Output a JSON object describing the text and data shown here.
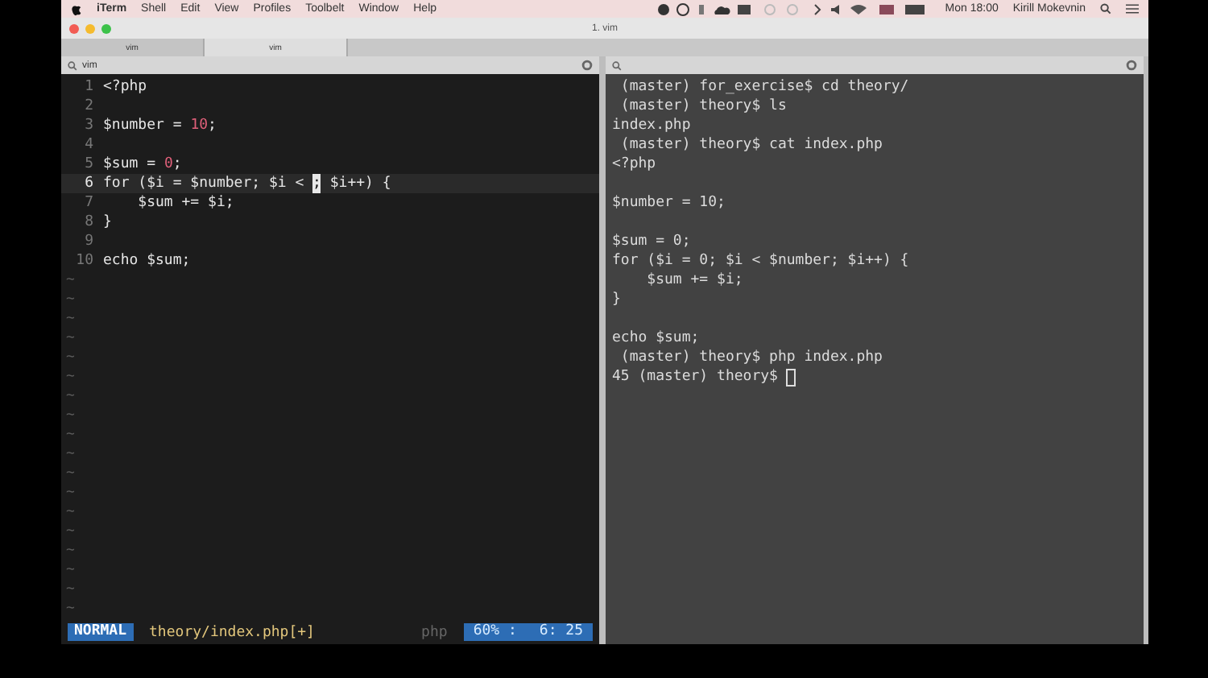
{
  "menu_bar": {
    "items": [
      "iTerm",
      "Shell",
      "Edit",
      "View",
      "Profiles",
      "Toolbelt",
      "Window",
      "Help"
    ],
    "clock": "Mon 18:00",
    "user": "Kirill Mokevnin"
  },
  "window": {
    "title": "1. vim"
  },
  "tabs": [
    {
      "label": "vim",
      "selected": false
    },
    {
      "label": "vim",
      "selected": true
    }
  ],
  "left_pane": {
    "title": "vim",
    "lines": [
      {
        "number": "1",
        "current": false,
        "tokens": [
          {
            "text": "<?php",
            "kind": "plain"
          }
        ]
      },
      {
        "number": "2",
        "current": false
      },
      {
        "number": "3",
        "current": false,
        "tokens": [
          {
            "text": "$number = ",
            "kind": "plain"
          },
          {
            "text": "10",
            "kind": "number"
          },
          {
            "text": ";",
            "kind": "plain"
          }
        ]
      },
      {
        "number": "4",
        "current": false
      },
      {
        "number": "5",
        "current": false,
        "tokens": [
          {
            "text": "$sum = ",
            "kind": "plain"
          },
          {
            "text": "0",
            "kind": "number"
          },
          {
            "text": ";",
            "kind": "plain"
          }
        ]
      },
      {
        "number": "6",
        "current": true,
        "tokens": [
          {
            "text": "for ($i = $number; $i < ",
            "kind": "plain"
          },
          {
            "text": ";",
            "kind": "cursor"
          },
          {
            "text": " $i++) {",
            "kind": "plain"
          }
        ]
      },
      {
        "number": "7",
        "current": false,
        "tokens": [
          {
            "text": "    $sum += $i;",
            "kind": "plain"
          }
        ]
      },
      {
        "number": "8",
        "current": false,
        "tokens": [
          {
            "text": "}",
            "kind": "plain"
          }
        ]
      },
      {
        "number": "9",
        "current": false
      },
      {
        "number": "10",
        "current": false,
        "tokens": [
          {
            "text": "echo $sum;",
            "kind": "plain"
          }
        ]
      }
    ],
    "filler_lines": [
      "~",
      "~",
      "~",
      "~",
      "~",
      "~",
      "~",
      "~",
      "~",
      "~",
      "~",
      "~",
      "~",
      "~",
      "~",
      "~",
      "~",
      "~"
    ],
    "status_line": {
      "mode": "NORMAL",
      "file": "theory/index.php[+]",
      "filetype": "php",
      "percent": "60% :",
      "position": "6: 25"
    }
  },
  "right_pane": {
    "lines": [
      {
        "kind": "text",
        "text": " (master) for_exercise$ cd theory/"
      },
      {
        "kind": "text",
        "text": " (master) theory$ ls"
      },
      {
        "kind": "text",
        "text": "index.php"
      },
      {
        "kind": "text",
        "text": " (master) theory$ cat index.php"
      },
      {
        "kind": "text",
        "text": "<?php"
      },
      {
        "kind": "blank"
      },
      {
        "kind": "text",
        "text": "$number = 10;"
      },
      {
        "kind": "blank"
      },
      {
        "kind": "text",
        "text": "$sum = 0;"
      },
      {
        "kind": "text",
        "text": "for ($i = 0; $i < $number; $i++) {"
      },
      {
        "kind": "text",
        "text": "    $sum += $i;"
      },
      {
        "kind": "text",
        "text": "}"
      },
      {
        "kind": "blank"
      },
      {
        "kind": "text",
        "text": "echo $sum;"
      },
      {
        "kind": "text",
        "text": " (master) theory$ php index.php"
      }
    ],
    "prompt": "45 (master) theory$ "
  }
}
